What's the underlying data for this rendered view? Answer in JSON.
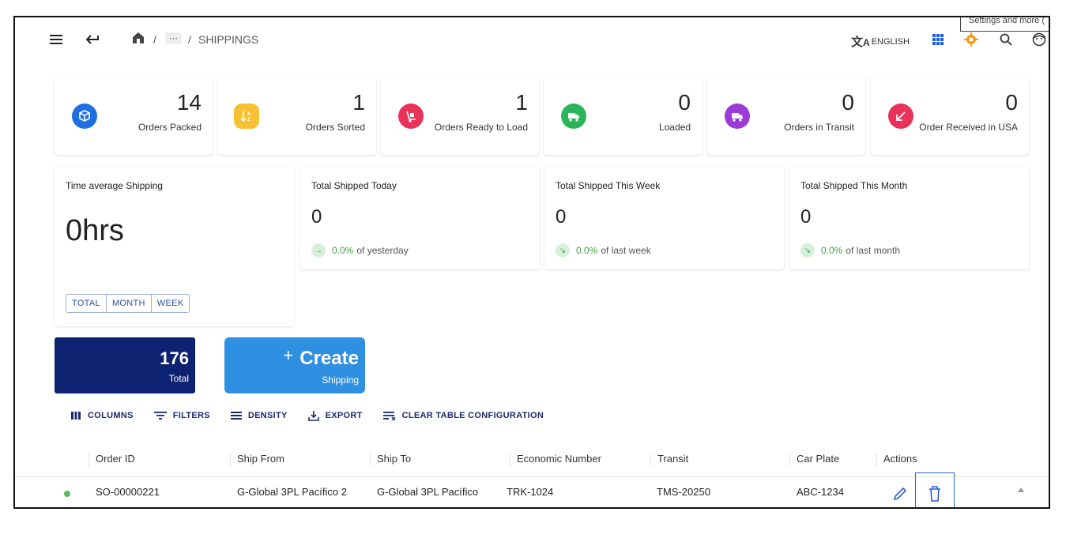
{
  "topbar": {
    "breadcrumb_sep1": "/",
    "breadcrumb_more": "⋯",
    "breadcrumb_sep2": "/",
    "breadcrumb_current": "SHIPPINGS",
    "language": "ENGLISH",
    "tooltip": "Settings and more (",
    "colors": {
      "apps": "#1e5bd8",
      "settings": "#f39c12"
    }
  },
  "stats": [
    {
      "value": "14",
      "label": "Orders Packed",
      "color": "#1e6fe0",
      "icon": "box-icon"
    },
    {
      "value": "1",
      "label": "Orders Sorted",
      "color": "#f6c132",
      "icon": "sort-icon"
    },
    {
      "value": "1",
      "label": "Orders Ready to Load",
      "color": "#e8325a",
      "icon": "hand-truck-icon"
    },
    {
      "value": "0",
      "label": "Loaded",
      "color": "#2bb55a",
      "icon": "truck-loaded-icon"
    },
    {
      "value": "0",
      "label": "Orders in Transit",
      "color": "#9b3ad6",
      "icon": "delivery-truck-icon"
    },
    {
      "value": "0",
      "label": "Order Received in USA",
      "color": "#e8325a",
      "icon": "arrow-down-left-icon"
    }
  ],
  "avg_card": {
    "title": "Time average Shipping",
    "value": "0hrs",
    "buttons": [
      "TOTAL",
      "MONTH",
      "WEEK"
    ]
  },
  "kpis": [
    {
      "title": "Total Shipped Today",
      "value": "0",
      "pct": "0.0%",
      "rest": "of yesterday",
      "trend_icon": "arrow-right-icon"
    },
    {
      "title": "Total Shipped This Week",
      "value": "0",
      "pct": "0.0%",
      "rest": "of last week",
      "trend_icon": "trend-down-icon"
    },
    {
      "title": "Total Shipped This Month",
      "value": "0",
      "pct": "0.0%",
      "rest": "of last month",
      "trend_icon": "trend-down-icon"
    }
  ],
  "total_box": {
    "value": "176",
    "label": "Total"
  },
  "create_box": {
    "plus": "+",
    "label": "Create",
    "sub": "Shipping"
  },
  "toolbar": {
    "columns": "COLUMNS",
    "filters": "FILTERS",
    "density": "DENSITY",
    "export": "EXPORT",
    "clear": "CLEAR TABLE CONFIGURATION"
  },
  "table": {
    "headers": [
      "Order ID",
      "Ship From",
      "Ship To",
      "Economic Number",
      "Transit",
      "Car Plate",
      "Actions"
    ],
    "rows": [
      {
        "order_id": "SO-00000221",
        "ship_from": "G-Global 3PL Pacífico 2",
        "ship_to": "G-Global 3PL Pacífico",
        "economic_number": "TRK-1024",
        "transit": "TMS-20250",
        "car_plate": "ABC-1234",
        "status_color": "#5cb85c"
      }
    ]
  }
}
